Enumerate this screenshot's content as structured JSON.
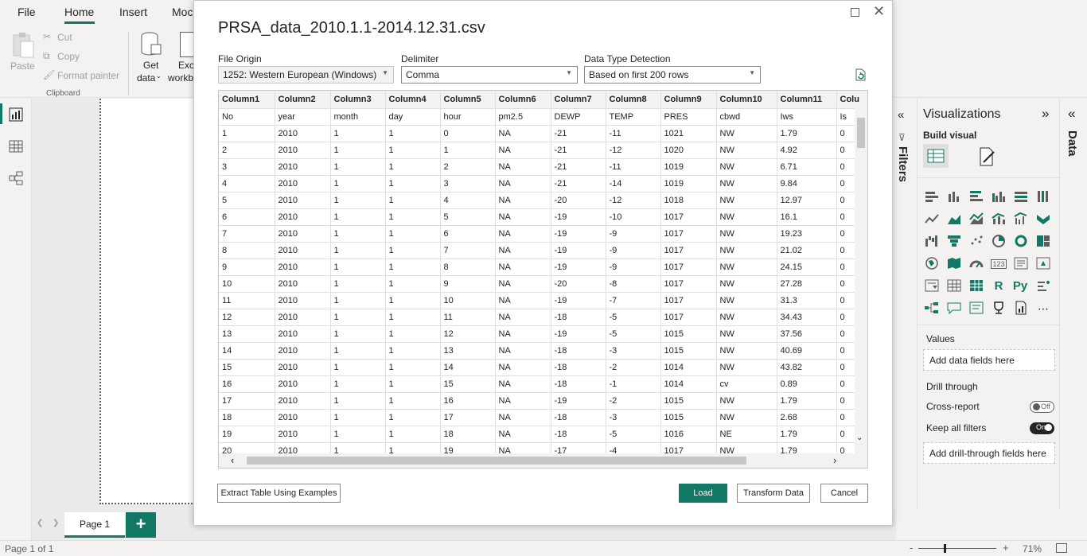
{
  "menubar": {
    "items": [
      "File",
      "Home",
      "Insert",
      "Moc"
    ],
    "active": "Home"
  },
  "ribbon": {
    "paste": "Paste",
    "cut": "Cut",
    "copy": "Copy",
    "format_painter": "Format painter",
    "clipboard_label": "Clipboard",
    "get_data_1": "Get",
    "get_data_2": "data",
    "excel_1": "Exc",
    "excel_2": "workb"
  },
  "dialog": {
    "title": "PRSA_data_2010.1.1-2014.12.31.csv",
    "file_origin_label": "File Origin",
    "file_origin_value": "1252: Western European (Windows)",
    "delimiter_label": "Delimiter",
    "delimiter_value": "Comma",
    "detection_label": "Data Type Detection",
    "detection_value": "Based on first 200 rows",
    "columns": [
      "Column1",
      "Column2",
      "Column3",
      "Column4",
      "Column5",
      "Column6",
      "Column7",
      "Column8",
      "Column9",
      "Column10",
      "Column11",
      "Colu"
    ],
    "rows": [
      [
        "No",
        "year",
        "month",
        "day",
        "hour",
        "pm2.5",
        "DEWP",
        "TEMP",
        "PRES",
        "cbwd",
        "Iws",
        "Is"
      ],
      [
        "1",
        "2010",
        "1",
        "1",
        "0",
        "NA",
        "-21",
        "-11",
        "1021",
        "NW",
        "1.79",
        "0"
      ],
      [
        "2",
        "2010",
        "1",
        "1",
        "1",
        "NA",
        "-21",
        "-12",
        "1020",
        "NW",
        "4.92",
        "0"
      ],
      [
        "3",
        "2010",
        "1",
        "1",
        "2",
        "NA",
        "-21",
        "-11",
        "1019",
        "NW",
        "6.71",
        "0"
      ],
      [
        "4",
        "2010",
        "1",
        "1",
        "3",
        "NA",
        "-21",
        "-14",
        "1019",
        "NW",
        "9.84",
        "0"
      ],
      [
        "5",
        "2010",
        "1",
        "1",
        "4",
        "NA",
        "-20",
        "-12",
        "1018",
        "NW",
        "12.97",
        "0"
      ],
      [
        "6",
        "2010",
        "1",
        "1",
        "5",
        "NA",
        "-19",
        "-10",
        "1017",
        "NW",
        "16.1",
        "0"
      ],
      [
        "7",
        "2010",
        "1",
        "1",
        "6",
        "NA",
        "-19",
        "-9",
        "1017",
        "NW",
        "19.23",
        "0"
      ],
      [
        "8",
        "2010",
        "1",
        "1",
        "7",
        "NA",
        "-19",
        "-9",
        "1017",
        "NW",
        "21.02",
        "0"
      ],
      [
        "9",
        "2010",
        "1",
        "1",
        "8",
        "NA",
        "-19",
        "-9",
        "1017",
        "NW",
        "24.15",
        "0"
      ],
      [
        "10",
        "2010",
        "1",
        "1",
        "9",
        "NA",
        "-20",
        "-8",
        "1017",
        "NW",
        "27.28",
        "0"
      ],
      [
        "11",
        "2010",
        "1",
        "1",
        "10",
        "NA",
        "-19",
        "-7",
        "1017",
        "NW",
        "31.3",
        "0"
      ],
      [
        "12",
        "2010",
        "1",
        "1",
        "11",
        "NA",
        "-18",
        "-5",
        "1017",
        "NW",
        "34.43",
        "0"
      ],
      [
        "13",
        "2010",
        "1",
        "1",
        "12",
        "NA",
        "-19",
        "-5",
        "1015",
        "NW",
        "37.56",
        "0"
      ],
      [
        "14",
        "2010",
        "1",
        "1",
        "13",
        "NA",
        "-18",
        "-3",
        "1015",
        "NW",
        "40.69",
        "0"
      ],
      [
        "15",
        "2010",
        "1",
        "1",
        "14",
        "NA",
        "-18",
        "-2",
        "1014",
        "NW",
        "43.82",
        "0"
      ],
      [
        "16",
        "2010",
        "1",
        "1",
        "15",
        "NA",
        "-18",
        "-1",
        "1014",
        "cv",
        "0.89",
        "0"
      ],
      [
        "17",
        "2010",
        "1",
        "1",
        "16",
        "NA",
        "-19",
        "-2",
        "1015",
        "NW",
        "1.79",
        "0"
      ],
      [
        "18",
        "2010",
        "1",
        "1",
        "17",
        "NA",
        "-18",
        "-3",
        "1015",
        "NW",
        "2.68",
        "0"
      ],
      [
        "19",
        "2010",
        "1",
        "1",
        "18",
        "NA",
        "-18",
        "-5",
        "1016",
        "NE",
        "1.79",
        "0"
      ],
      [
        "20",
        "2010",
        "1",
        "1",
        "19",
        "NA",
        "-17",
        "-4",
        "1017",
        "NW",
        "1.79",
        "0"
      ]
    ],
    "extract_button": "Extract Table Using Examples",
    "load_button": "Load",
    "transform_button": "Transform Data",
    "cancel_button": "Cancel"
  },
  "filters_pane": {
    "label": "Filters"
  },
  "viz_pane": {
    "title": "Visualizations",
    "build_visual": "Build visual",
    "values_label": "Values",
    "values_placeholder": "Add data fields here",
    "drill_through": "Drill through",
    "cross_report": "Cross-report",
    "cross_report_state": "Off",
    "keep_filters": "Keep all filters",
    "keep_filters_state": "On",
    "drill_placeholder": "Add drill-through fields here",
    "r_visual": "R",
    "py_visual": "Py",
    "more": "⋯"
  },
  "data_pane": {
    "label": "Data"
  },
  "pagebar": {
    "page_tab": "Page 1",
    "add": "+"
  },
  "statusbar": {
    "page_info": "Page 1 of 1",
    "zoom": "71%",
    "zoom_minus": "-",
    "zoom_plus": "+"
  },
  "colors": {
    "accent": "#117865",
    "background": "#f3f2f1",
    "canvas": "#eaeaea"
  }
}
